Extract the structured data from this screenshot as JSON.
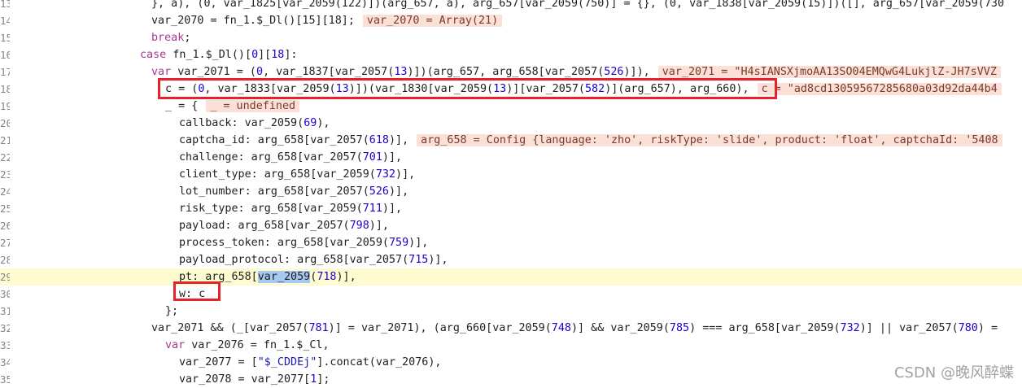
{
  "editor": {
    "current_line_number": "29",
    "lines": [
      {
        "number": "13",
        "indent": 186,
        "tokens": [
          {
            "t": "}, a), (0, var_1825[var_2059(122)])(arg_657, a), arg_657[var_2059(750)] = {}, (0, var_1838[var_2059(15)])([], arg_657[var_2059(730",
            "c": "plain"
          }
        ]
      },
      {
        "number": "14",
        "indent": 186,
        "tokens": [
          {
            "t": "var_2070 = fn_1.$_Dl()[15][18];",
            "c": "plain"
          },
          {
            "t": "var_2070 = Array(21)",
            "c": "inline"
          }
        ]
      },
      {
        "number": "15",
        "indent": 186,
        "tokens": [
          {
            "t": "break",
            "c": "kw"
          },
          {
            "t": ";",
            "c": "plain"
          }
        ]
      },
      {
        "number": "16",
        "indent": 172,
        "tokens": [
          {
            "t": "case",
            "c": "kw"
          },
          {
            "t": " fn_1.$_Dl()[",
            "c": "plain"
          },
          {
            "t": "0",
            "c": "num"
          },
          {
            "t": "][",
            "c": "plain"
          },
          {
            "t": "18",
            "c": "num"
          },
          {
            "t": "]:",
            "c": "plain"
          }
        ]
      },
      {
        "number": "17",
        "indent": 186,
        "tokens": [
          {
            "t": "var",
            "c": "kw"
          },
          {
            "t": " var_2071 = (",
            "c": "plain"
          },
          {
            "t": "0",
            "c": "num"
          },
          {
            "t": ", var_1837[var_2057(",
            "c": "plain"
          },
          {
            "t": "13",
            "c": "num"
          },
          {
            "t": ")])(arg_657, arg_658[var_2057(",
            "c": "plain"
          },
          {
            "t": "526",
            "c": "num"
          },
          {
            "t": ")]),",
            "c": "plain"
          },
          {
            "t": "var_2071 = \"H4sIANSXjmoAA13SO04EMQwG4LukjlZ-JH7sVVZ",
            "c": "inline"
          }
        ]
      },
      {
        "number": "18",
        "indent": 203,
        "tokens": [
          {
            "t": "c = (",
            "c": "plain"
          },
          {
            "t": "0",
            "c": "num"
          },
          {
            "t": ", var_1833[var_2059(",
            "c": "plain"
          },
          {
            "t": "13",
            "c": "num"
          },
          {
            "t": ")])(var_1830[var_2059(",
            "c": "plain"
          },
          {
            "t": "13",
            "c": "num"
          },
          {
            "t": ")][var_2057(",
            "c": "plain"
          },
          {
            "t": "582",
            "c": "num"
          },
          {
            "t": ")](arg_657), arg_660),",
            "c": "plain"
          },
          {
            "t": "c = \"ad8cd13059567285680a03d92da44b4",
            "c": "inline"
          }
        ]
      },
      {
        "number": "19",
        "indent": 203,
        "tokens": [
          {
            "t": "_ = {",
            "c": "plain"
          },
          {
            "t": "_ = undefined",
            "c": "inline"
          }
        ]
      },
      {
        "number": "20",
        "indent": 220,
        "tokens": [
          {
            "t": "callback: var_2059(",
            "c": "plain"
          },
          {
            "t": "69",
            "c": "num"
          },
          {
            "t": "),",
            "c": "plain"
          }
        ]
      },
      {
        "number": "21",
        "indent": 220,
        "tokens": [
          {
            "t": "captcha_id: arg_658[var_2057(",
            "c": "plain"
          },
          {
            "t": "618",
            "c": "num"
          },
          {
            "t": ")],",
            "c": "plain"
          },
          {
            "t": "arg_658 = Config {language: 'zho', riskType: 'slide', product: 'float', captchaId: '5408",
            "c": "inline"
          }
        ]
      },
      {
        "number": "22",
        "indent": 220,
        "tokens": [
          {
            "t": "challenge: arg_658[var_2057(",
            "c": "plain"
          },
          {
            "t": "701",
            "c": "num"
          },
          {
            "t": ")],",
            "c": "plain"
          }
        ]
      },
      {
        "number": "23",
        "indent": 220,
        "tokens": [
          {
            "t": "client_type: arg_658[var_2059(",
            "c": "plain"
          },
          {
            "t": "732",
            "c": "num"
          },
          {
            "t": ")],",
            "c": "plain"
          }
        ]
      },
      {
        "number": "24",
        "indent": 220,
        "tokens": [
          {
            "t": "lot_number: arg_658[var_2057(",
            "c": "plain"
          },
          {
            "t": "526",
            "c": "num"
          },
          {
            "t": ")],",
            "c": "plain"
          }
        ]
      },
      {
        "number": "25",
        "indent": 220,
        "tokens": [
          {
            "t": "risk_type: arg_658[var_2059(",
            "c": "plain"
          },
          {
            "t": "711",
            "c": "num"
          },
          {
            "t": ")],",
            "c": "plain"
          }
        ]
      },
      {
        "number": "26",
        "indent": 220,
        "tokens": [
          {
            "t": "payload: arg_658[var_2057(",
            "c": "plain"
          },
          {
            "t": "798",
            "c": "num"
          },
          {
            "t": ")],",
            "c": "plain"
          }
        ]
      },
      {
        "number": "27",
        "indent": 220,
        "tokens": [
          {
            "t": "process_token: arg_658[var_2059(",
            "c": "plain"
          },
          {
            "t": "759",
            "c": "num"
          },
          {
            "t": ")],",
            "c": "plain"
          }
        ]
      },
      {
        "number": "28",
        "indent": 220,
        "tokens": [
          {
            "t": "payload_protocol: arg_658[var_2057(",
            "c": "plain"
          },
          {
            "t": "715",
            "c": "num"
          },
          {
            "t": ")],",
            "c": "plain"
          }
        ]
      },
      {
        "number": "29",
        "indent": 220,
        "tokens": [
          {
            "t": "pt: arg_658[",
            "c": "plain"
          },
          {
            "t": "var_2059",
            "c": "sel"
          },
          {
            "t": "(",
            "c": "plain"
          },
          {
            "t": "718",
            "c": "num"
          },
          {
            "t": ")],",
            "c": "plain"
          }
        ]
      },
      {
        "number": "30",
        "indent": 220,
        "tokens": [
          {
            "t": "w: c",
            "c": "plain"
          }
        ]
      },
      {
        "number": "31",
        "indent": 203,
        "tokens": [
          {
            "t": "};",
            "c": "plain"
          }
        ]
      },
      {
        "number": "32",
        "indent": 186,
        "tokens": [
          {
            "t": "var_2071 && (_[var_2057(",
            "c": "plain"
          },
          {
            "t": "781",
            "c": "num"
          },
          {
            "t": ")] = var_2071), (arg_660[var_2059(",
            "c": "plain"
          },
          {
            "t": "748",
            "c": "num"
          },
          {
            "t": ")] && var_2059(",
            "c": "plain"
          },
          {
            "t": "785",
            "c": "num"
          },
          {
            "t": ") === arg_658[var_2059(",
            "c": "plain"
          },
          {
            "t": "732",
            "c": "num"
          },
          {
            "t": ")] || var_2057(",
            "c": "plain"
          },
          {
            "t": "780",
            "c": "num"
          },
          {
            "t": ") =",
            "c": "plain"
          }
        ]
      },
      {
        "number": "33",
        "indent": 203,
        "tokens": [
          {
            "t": "var",
            "c": "kw"
          },
          {
            "t": " var_2076 = fn_1.$_Cl,",
            "c": "plain"
          }
        ]
      },
      {
        "number": "34",
        "indent": 220,
        "tokens": [
          {
            "t": "var_2077 = [",
            "c": "plain"
          },
          {
            "t": "\"$_CDDEj\"",
            "c": "str"
          },
          {
            "t": "].concat(var_2076),",
            "c": "plain"
          }
        ]
      },
      {
        "number": "35",
        "indent": 220,
        "tokens": [
          {
            "t": "var_2078 = var_2077[",
            "c": "plain"
          },
          {
            "t": "1",
            "c": "num"
          },
          {
            "t": "];",
            "c": "plain"
          }
        ]
      }
    ]
  },
  "watermark": "CSDN @晚风醉蝶"
}
